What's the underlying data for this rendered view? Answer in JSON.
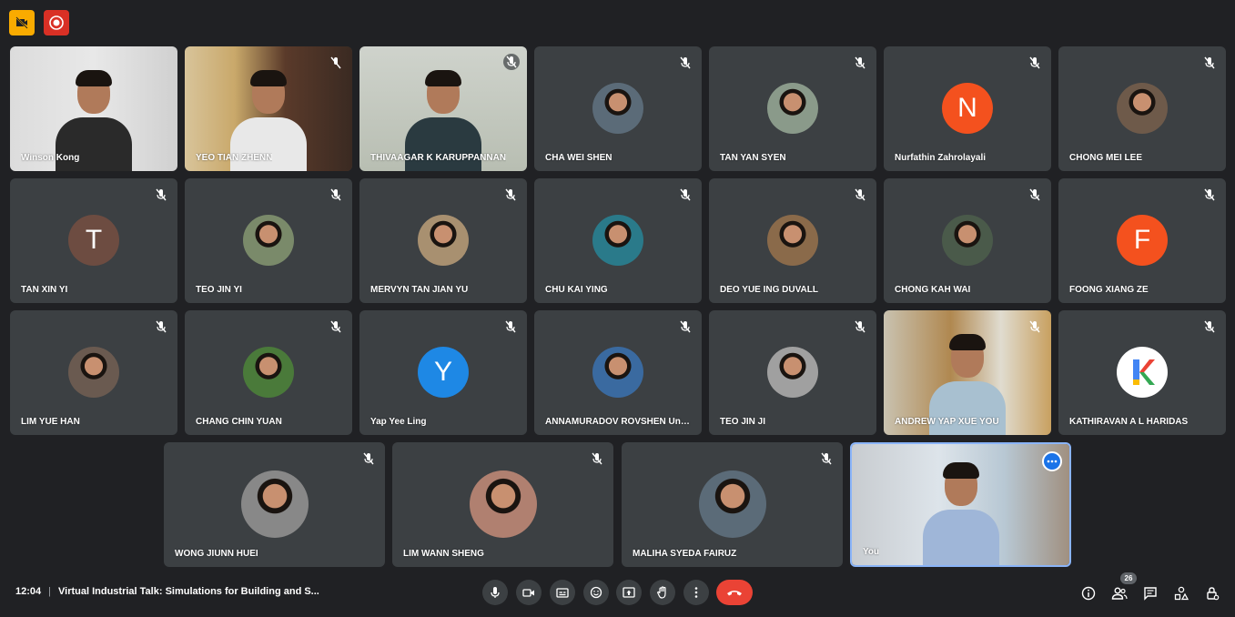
{
  "clock": "12:04",
  "separator": "|",
  "meeting_title": "Virtual Industrial Talk: Simulations for Building and S...",
  "participant_count": "26",
  "participants": [
    {
      "name": "Winson Kong",
      "type": "video"
    },
    {
      "name": "YEO TIAN ZHENN",
      "type": "video"
    },
    {
      "name": "THIVAAGAR K KARUPPANNAN",
      "type": "video"
    },
    {
      "name": "CHA WEI SHEN",
      "type": "photo"
    },
    {
      "name": "TAN YAN SYEN",
      "type": "photo"
    },
    {
      "name": "Nurfathin Zahrolayali",
      "type": "letter",
      "letter": "N",
      "color": "#f4511e"
    },
    {
      "name": "CHONG MEI LEE",
      "type": "photo"
    },
    {
      "name": "TAN XIN YI",
      "type": "letter",
      "letter": "T",
      "color": "#6d4c41"
    },
    {
      "name": "TEO JIN YI",
      "type": "photo"
    },
    {
      "name": "MERVYN TAN JIAN YU",
      "type": "photo"
    },
    {
      "name": "CHU KAI YING",
      "type": "photo"
    },
    {
      "name": "DEO YUE ING DUVALL",
      "type": "photo"
    },
    {
      "name": "CHONG KAH WAI",
      "type": "photo"
    },
    {
      "name": "FOONG XIANG ZE",
      "type": "letter",
      "letter": "F",
      "color": "#f4511e"
    },
    {
      "name": "LIM YUE HAN",
      "type": "photo"
    },
    {
      "name": "CHANG CHIN YUAN",
      "type": "photo"
    },
    {
      "name": "Yap Yee Ling",
      "type": "letter",
      "letter": "Y",
      "color": "#1e88e5"
    },
    {
      "name": "ANNAMURADOV ROVSHEN Unk...",
      "type": "photo"
    },
    {
      "name": "TEO JIN JI",
      "type": "photo"
    },
    {
      "name": "ANDREW YAP XUE YOU",
      "type": "video"
    },
    {
      "name": "KATHIRAVAN A L HARIDAS",
      "type": "logo"
    },
    {
      "name": "WONG JIUNN HUEI",
      "type": "photo"
    },
    {
      "name": "LIM WANN SHENG",
      "type": "photo"
    },
    {
      "name": "MALIHA SYEDA FAIRUZ",
      "type": "photo"
    },
    {
      "name": "You",
      "type": "video"
    }
  ],
  "controls": [
    "microphone-icon",
    "camera-icon",
    "captions-icon",
    "emoji-icon",
    "present-icon",
    "raise-hand-icon",
    "more-options-icon",
    "end-call-icon"
  ],
  "right_icons": [
    "info-icon",
    "people-icon",
    "chat-icon",
    "activities-icon",
    "host-controls-icon"
  ],
  "colors": {
    "background": "#202124",
    "tile": "#3c4043",
    "end_call": "#ea4335",
    "accent": "#8ab4f8",
    "recording": "#ea4335",
    "warning": "#f9ab00"
  }
}
